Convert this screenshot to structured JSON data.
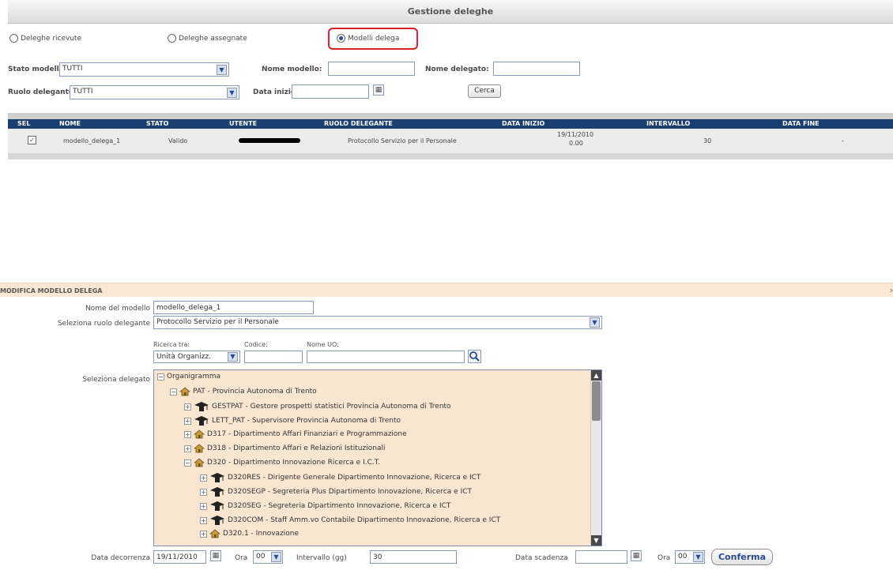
{
  "title": "Gestione deleghe",
  "radios": [
    {
      "label": "Deleghe ricevute",
      "checked": false
    },
    {
      "label": "Deleghe assegnate",
      "checked": false
    },
    {
      "label": "Modelli delega",
      "checked": true
    }
  ],
  "filters": {
    "stato_label": "Stato modello:",
    "stato_value": "TUTTI",
    "nome_modello_label": "Nome modello:",
    "nome_modello_value": "",
    "nome_delegato_label": "Nome delegato:",
    "nome_delegato_value": "",
    "ruolo_label": "Ruolo delegante:",
    "ruolo_value": "TUTTI",
    "data_inizio_label": "Data inizio:",
    "data_inizio_value": "",
    "search_button": "Cerca"
  },
  "grid": {
    "columns": [
      "SEL",
      "NOME",
      "STATO",
      "UTENTE",
      "RUOLO DELEGANTE",
      "DATA INIZIO",
      "INTERVALLO",
      "DATA FINE"
    ],
    "rows": [
      {
        "selected": true,
        "nome": "modello_delega_1",
        "stato": "Valido",
        "utente": "",
        "ruolo": "Protocollo Servizio per il Personale",
        "data_inizio": "19/11/2010",
        "data_inizio_ora": "0.00",
        "intervallo": "30",
        "data_fine": "-"
      }
    ]
  },
  "edit": {
    "section_title": "MODIFICA MODELLO DELEGA",
    "nome_label": "Nome del modello",
    "nome_value": "modello_delega_1",
    "ruolo_label": "Seleziona ruolo delegante",
    "ruolo_value": "Protocollo Servizio per il Personale",
    "ricerca_label": "Ricerca tra:",
    "codice_label": "Codice:",
    "nome_uo_label": "Nome UO:",
    "ricerca_value": "Unità Organizz.",
    "codice_value": "",
    "nome_uo_value": "",
    "delegato_label": "Seleziona delegato",
    "tree": [
      {
        "label": "Organigramma",
        "level": 0,
        "icon": "none",
        "expander": "−"
      },
      {
        "label": "PAT - Provincia Autonoma di Trento",
        "level": 1,
        "icon": "house-icon",
        "expander": "−"
      },
      {
        "label": "GESTPAT - Gestore prospetti statistici Provincia Autonoma di Trento",
        "level": 2,
        "icon": "person-icon",
        "expander": "+"
      },
      {
        "label": "LETT_PAT - Supervisore Provincia Autonoma di Trento",
        "level": 2,
        "icon": "person-icon",
        "expander": "+"
      },
      {
        "label": "D317 - Dipartimento Affari Finanziari e Programmazione",
        "level": 2,
        "icon": "house-icon",
        "expander": "+"
      },
      {
        "label": "D318 - Dipartimento Affari e Relazioni Istituzionali",
        "level": 2,
        "icon": "house-icon",
        "expander": "+"
      },
      {
        "label": "D320 - Dipartimento Innovazione Ricerca e I.C.T.",
        "level": 2,
        "icon": "house-icon",
        "expander": "−"
      },
      {
        "label": "D320RES - Dirigente Generale Dipartimento Innovazione, Ricerca e ICT",
        "level": 3,
        "icon": "person-icon",
        "expander": "+"
      },
      {
        "label": "D320SEGP - Segreteria Plus Dipartimento Innovazione, Ricerca e ICT",
        "level": 3,
        "icon": "person-icon",
        "expander": "+"
      },
      {
        "label": "D320SEG - Segreteria Dipartimento Innovazione, Ricerca e ICT",
        "level": 3,
        "icon": "person-icon",
        "expander": "+"
      },
      {
        "label": "D320COM - Staff Amm.vo Contabile Dipartimento Innovazione, Ricerca e ICT",
        "level": 3,
        "icon": "person-icon",
        "expander": "+"
      },
      {
        "label": "D320.1 - Innovazione",
        "level": 3,
        "icon": "house-icon",
        "expander": "+"
      }
    ],
    "decorrenza_label": "Data decorrenza",
    "decorrenza_value": "19/11/2010",
    "ora_label": "Ora",
    "ora_value": "00",
    "intervallo_label": "Intervallo (gg)",
    "intervallo_value": "30",
    "scadenza_label": "Data scadenza",
    "scadenza_value": "",
    "ora2_label": "Ora",
    "ora2_value": "00",
    "confirm_button": "Conferma"
  }
}
